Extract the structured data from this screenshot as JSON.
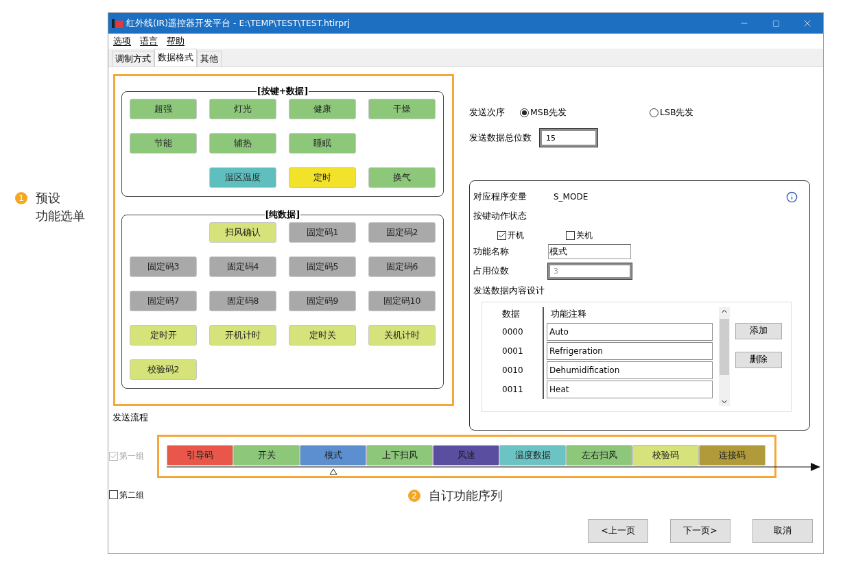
{
  "callouts": [
    {
      "number": "1",
      "lines": [
        "预设",
        "功能选单"
      ]
    },
    {
      "number": "2",
      "lines": [
        "自订功能序列"
      ]
    }
  ],
  "window": {
    "title": "红外线(IR)遥控器开发平台 - E:\\TEMP\\TEST\\TEST.htirprj"
  },
  "menu": [
    "选项",
    "语言",
    "帮助"
  ],
  "tabs": [
    {
      "label": "调制方式",
      "selected": false
    },
    {
      "label": "数据格式",
      "selected": true
    },
    {
      "label": "其他",
      "selected": false
    }
  ],
  "groups": [
    {
      "title": "[按键+数据]",
      "rows": [
        [
          {
            "label": "超强",
            "color": "#8dc77a"
          },
          {
            "label": "灯光",
            "color": "#8dc77a"
          },
          {
            "label": "健康",
            "color": "#8dc77a"
          },
          {
            "label": "干燥",
            "color": "#8dc77a"
          }
        ],
        [
          {
            "label": "节能",
            "color": "#8dc77a"
          },
          {
            "label": "辅热",
            "color": "#8dc77a"
          },
          {
            "label": "睡眠",
            "color": "#8dc77a"
          }
        ],
        [
          "",
          {
            "label": "温区温度",
            "color": "#5fbfbf"
          },
          {
            "label": "定时",
            "color": "#f2e22a"
          },
          {
            "label": "换气",
            "color": "#8dc77a"
          }
        ]
      ]
    },
    {
      "title": "[纯数据]",
      "rows": [
        [
          "",
          {
            "label": "扫风确认",
            "color": "#d5e37a"
          },
          {
            "label": "固定码1",
            "color": "#a9a9a9"
          },
          {
            "label": "固定码2",
            "color": "#a9a9a9"
          }
        ],
        [
          {
            "label": "固定码3",
            "color": "#a9a9a9"
          },
          {
            "label": "固定码4",
            "color": "#a9a9a9"
          },
          {
            "label": "固定码5",
            "color": "#a9a9a9"
          },
          {
            "label": "固定码6",
            "color": "#a9a9a9"
          }
        ],
        [
          {
            "label": "固定码7",
            "color": "#a9a9a9"
          },
          {
            "label": "固定码8",
            "color": "#a9a9a9"
          },
          {
            "label": "固定码9",
            "color": "#a9a9a9"
          },
          {
            "label": "固定码10",
            "color": "#a9a9a9"
          }
        ],
        [
          {
            "label": "定时开",
            "color": "#d5e37a"
          },
          {
            "label": "开机计时",
            "color": "#d5e37a"
          },
          {
            "label": "定时关",
            "color": "#d5e37a"
          },
          {
            "label": "关机计时",
            "color": "#d5e37a"
          }
        ],
        [
          {
            "label": "校验码2",
            "color": "#d5e37a"
          }
        ]
      ]
    }
  ],
  "send_order": {
    "label": "发送次序",
    "options": [
      {
        "label": "MSB先发",
        "selected": true
      },
      {
        "label": "LSB先发",
        "selected": false
      }
    ]
  },
  "total_bits": {
    "label": "发送数据总位数",
    "value": "15"
  },
  "detail": {
    "variable_label": "对应程序变量",
    "variable": "S_MODE",
    "action_label": "按键动作状态",
    "actions": [
      {
        "label": "开机",
        "checked": true
      },
      {
        "label": "关机",
        "checked": false
      }
    ],
    "name_label": "功能名称",
    "name": "模式",
    "bits_label": "占用位数",
    "bits": "3",
    "content_label": "发送数据内容设计",
    "table": {
      "columns": [
        "数据",
        "功能注释"
      ],
      "rows": [
        {
          "data": "0000",
          "note": "Auto"
        },
        {
          "data": "0001",
          "note": "Refrigeration"
        },
        {
          "data": "0010",
          "note": "Dehumidification"
        },
        {
          "data": "0011",
          "note": "Heat"
        }
      ]
    },
    "buttons": [
      "添加",
      "删除"
    ]
  },
  "flow": {
    "label": "发送流程",
    "groups": [
      {
        "label": "第一组",
        "checked": true,
        "disabled": true,
        "sequence": [
          {
            "label": "引导码",
            "color": "#e8574a",
            "selected": false
          },
          {
            "label": "开关",
            "color": "#8dc77a",
            "selected": false
          },
          {
            "label": "模式",
            "color": "#5b8fcf",
            "selected": true
          },
          {
            "label": "上下扫风",
            "color": "#8dc77a",
            "selected": false
          },
          {
            "label": "风速",
            "color": "#5a4ea0",
            "selected": false
          },
          {
            "label": "温度数据",
            "color": "#6cc3c3",
            "selected": false
          },
          {
            "label": "左右扫风",
            "color": "#8dc77a",
            "selected": false
          },
          {
            "label": "校验码",
            "color": "#d5e37a",
            "selected": false
          },
          {
            "label": "连接码",
            "color": "#b09a3a",
            "selected": false
          }
        ]
      },
      {
        "label": "第二组",
        "checked": false,
        "disabled": false
      }
    ]
  },
  "nav_buttons": [
    "<上一页",
    "下一页>",
    "取消"
  ]
}
